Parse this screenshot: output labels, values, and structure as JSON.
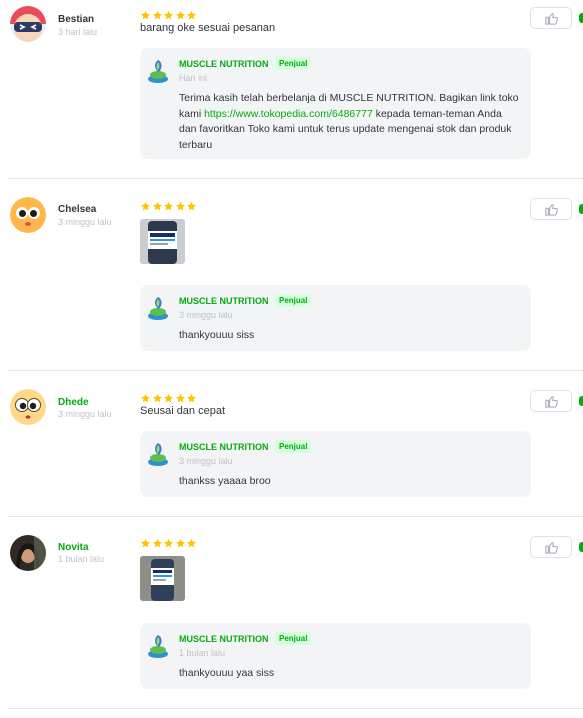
{
  "reviews": [
    {
      "user": "Bestian",
      "time": "3 hari lalu",
      "rating": 5,
      "text": "barang oke sesuai pesanan",
      "has_photo": false,
      "reply": {
        "seller": "MUSCLE NUTRITION",
        "badge": "Penjual",
        "time": "Hari ini",
        "text_before": "Terima kasih telah berbelanja di MUSCLE NUTRITION. Bagikan link toko kami ",
        "link": "https://www.tokopedia.com/6486777",
        "text_after": " kepada teman-teman Anda dan favoritkan Toko kami untuk terus update mengenai stok dan produk terbaru"
      }
    },
    {
      "user": "Chelsea",
      "time": "3 minggu lalu",
      "rating": 5,
      "text": "",
      "has_photo": true,
      "reply": {
        "seller": "MUSCLE NUTRITION",
        "badge": "Penjual",
        "time": "3 minggu lalu",
        "text": "thankyouuu siss"
      }
    },
    {
      "user": "Dhede",
      "time": "3 minggu lalu",
      "rating": 5,
      "text": "Seusai dan cepat",
      "has_photo": false,
      "reply": {
        "seller": "MUSCLE NUTRITION",
        "badge": "Penjual",
        "time": "3 minggu lalu",
        "text": "thankss yaaaa broo"
      }
    },
    {
      "user": "Novita",
      "time": "1 bulan lalu",
      "rating": 5,
      "text": "",
      "has_photo": true,
      "reply": {
        "seller": "MUSCLE NUTRITION",
        "badge": "Penjual",
        "time": "1 bulan lalu",
        "text": "thankyouuu yaa siss"
      }
    }
  ],
  "colors": {
    "accent_green": "#03ac0e",
    "star_yellow": "#ffc400",
    "muted_text": "#bfc3c8"
  },
  "icons": {
    "star": "star-icon",
    "like": "thumbs-up-icon",
    "seller_logo": "seller-logo-icon"
  }
}
